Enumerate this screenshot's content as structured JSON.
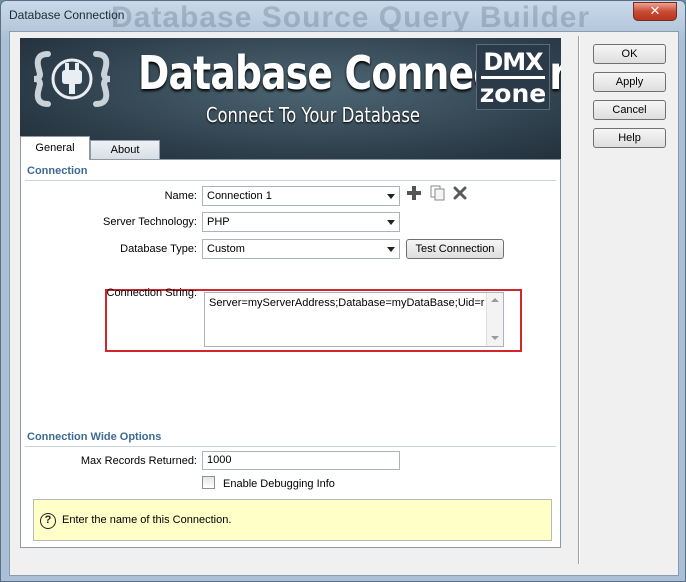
{
  "window": {
    "title": "Database Connection",
    "ghost_title": "Database Source Query Builder",
    "close_label": "✕"
  },
  "side_buttons": {
    "ok": "OK",
    "apply": "Apply",
    "cancel": "Cancel",
    "help": "Help"
  },
  "banner": {
    "title": "Database Connection",
    "subtitle": "Connect To Your Database",
    "logo_top": "DMX",
    "logo_bottom": "zone",
    "plug_icon": "plug-braces-icon"
  },
  "tabs": [
    {
      "label": "General",
      "active": true
    },
    {
      "label": "About",
      "active": false
    }
  ],
  "connection": {
    "section_title": "Connection",
    "name_label": "Name:",
    "name_value": "Connection 1",
    "server_tech_label": "Server Technology:",
    "server_tech_value": "PHP",
    "db_type_label": "Database Type:",
    "db_type_value": "Custom",
    "test_button": "Test Connection",
    "conn_string_label": "Connection String:",
    "conn_string_value": "Server=myServerAddress;Database=myDataBase;Uid=r",
    "icons": [
      "add-icon",
      "copy-icon",
      "delete-icon"
    ]
  },
  "options": {
    "section_title": "Connection Wide Options",
    "max_records_label": "Max Records Returned:",
    "max_records_value": "1000",
    "debug_label": "Enable Debugging Info",
    "debug_checked": false
  },
  "help": {
    "icon": "?",
    "text": "Enter the name of this Connection."
  },
  "colors": {
    "section_title": "#3d6a94",
    "highlight": "#d3262a",
    "help_bg": "#ffffc8",
    "close": "#c94b33"
  }
}
